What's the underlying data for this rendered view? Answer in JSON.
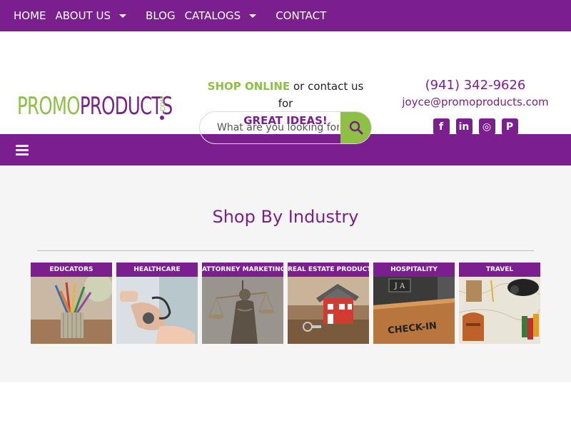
{
  "topnav": {
    "items": [
      {
        "label": "HOME",
        "has_dropdown": false
      },
      {
        "label": "ABOUT US",
        "has_dropdown": true
      },
      {
        "label": "BLOG",
        "has_dropdown": false
      },
      {
        "label": "CATALOGS",
        "has_dropdown": true
      },
      {
        "label": "CONTACT",
        "has_dropdown": false
      }
    ]
  },
  "brand": {
    "logo_part1": "PROMO",
    "logo_part2": "PRODUCTS",
    "logo_suffix": ".COM",
    "colors": {
      "purple": "#7b1f8e",
      "green": "#8dc044"
    }
  },
  "tagline": {
    "shop_online": "SHOP ONLINE",
    "middle": " or contact us for",
    "great_ideas": "GREAT IDEAS!"
  },
  "search": {
    "placeholder": "What are you looking for?",
    "icon": "search-icon"
  },
  "contact": {
    "phone": "(941) 342-9626",
    "email": "joyce@promoproducts.com",
    "social": [
      {
        "name": "facebook-icon",
        "glyph": "f"
      },
      {
        "name": "linkedin-icon",
        "glyph": "in"
      },
      {
        "name": "instagram-icon",
        "glyph": "◎"
      },
      {
        "name": "pinterest-icon",
        "glyph": "P"
      }
    ]
  },
  "menubar": {
    "icon": "hamburger-menu-icon"
  },
  "main": {
    "heading": "Shop By Industry",
    "industries": [
      {
        "label": "EDUCATORS",
        "image": "pencil-cup-image"
      },
      {
        "label": "HEALTHCARE",
        "image": "blood-pressure-image"
      },
      {
        "label": "ATTORNEY MARKETING",
        "image": "lady-justice-image"
      },
      {
        "label": "REAL ESTATE PRODUCTS",
        "image": "house-key-image"
      },
      {
        "label": "HOSPITALITY",
        "image": "check-in-desk-image"
      },
      {
        "label": "TRAVEL",
        "image": "travel-map-image"
      }
    ]
  }
}
